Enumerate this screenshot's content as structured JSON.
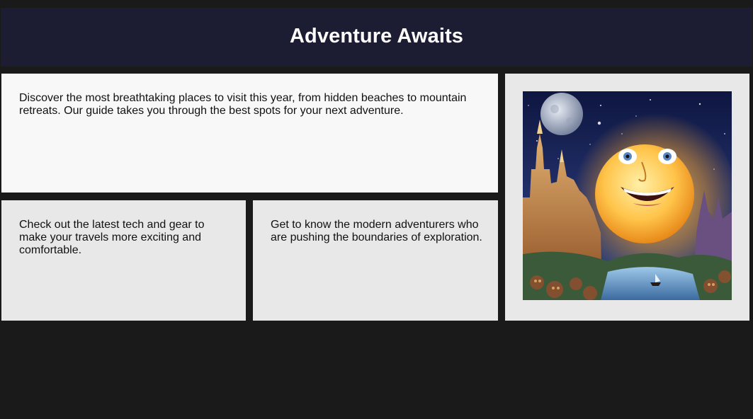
{
  "header": {
    "title": "Adventure Awaits"
  },
  "feature": {
    "text": "Discover the most breathtaking places to visit this year, from hidden beaches to mountain retreats. Our guide takes you through the best spots for your next adventure."
  },
  "tech": {
    "text": "Check out the latest tech and gear to make your travels more exciting and comfortable."
  },
  "people": {
    "text": "Get to know the modern adventurers who are pushing the boundaries of exploration."
  },
  "image": {
    "icon": "smiling-moon-fantasy-illustration"
  },
  "colors": {
    "background": "#1a1a1a",
    "header": "#1c1c32",
    "card_light": "#f8f8f8",
    "card": "#e8e8e8"
  }
}
